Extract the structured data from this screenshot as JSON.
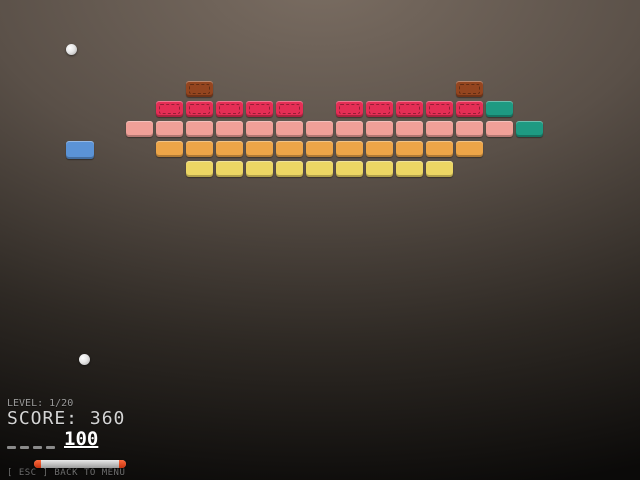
{
  "hud": {
    "level": "LEVEL: 1/20",
    "score": "SCORE: 360",
    "power": "100",
    "hint": "[ ESC ] BACK TO MENU"
  },
  "lives_remaining": 4,
  "colors": {
    "red": "#e52e55",
    "pink": "#f0a098",
    "orange": "#eda548",
    "yellow": "#ecd664",
    "teal": "#1e9a82",
    "brown": "#94451f",
    "blue": "#5b93d6"
  },
  "bricks": {
    "row1": [
      "",
      "",
      "brown",
      "",
      "",
      "",
      "",
      "",
      "",
      "",
      "",
      "brown",
      "",
      ""
    ],
    "row2": [
      "",
      "red",
      "red",
      "red",
      "red",
      "red",
      "",
      "red",
      "red",
      "red",
      "red",
      "red",
      "teal",
      ""
    ],
    "row3": [
      "pink",
      "pink",
      "pink",
      "pink",
      "pink",
      "pink",
      "pink",
      "pink",
      "pink",
      "pink",
      "pink",
      "pink",
      "pink",
      "teal"
    ],
    "row4": [
      "",
      "orange",
      "orange",
      "orange",
      "orange",
      "orange",
      "orange",
      "orange",
      "orange",
      "orange",
      "orange",
      "orange",
      "",
      ""
    ],
    "row5": [
      "",
      "",
      "yellow",
      "yellow",
      "yellow",
      "yellow",
      "yellow",
      "yellow",
      "yellow",
      "yellow",
      "yellow",
      "",
      "",
      ""
    ],
    "loose": [
      "blue"
    ]
  },
  "balls_count": 2
}
